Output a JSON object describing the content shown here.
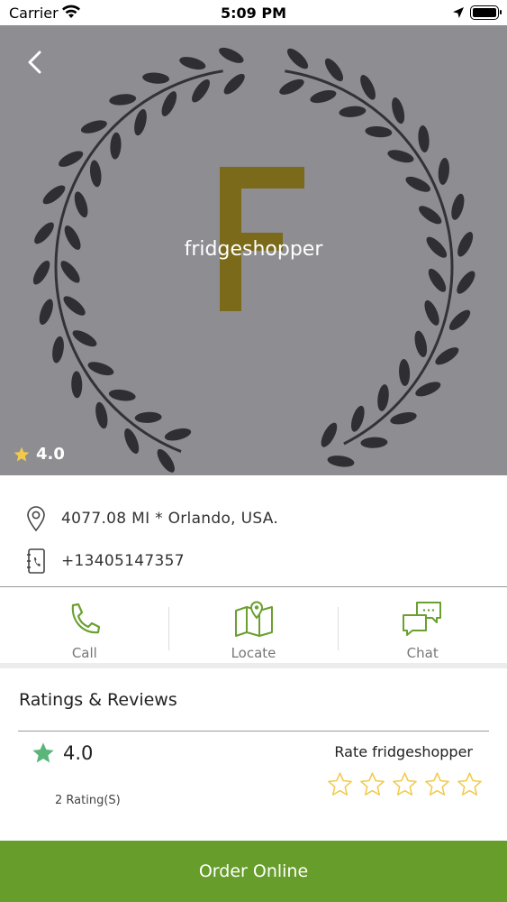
{
  "status_bar": {
    "carrier": "Carrier",
    "time": "5:09 PM"
  },
  "store": {
    "name": "fridgeshopper",
    "logo_letter": "F",
    "rating": "4.0",
    "address": "4077.08 MI * Orlando, USA.",
    "phone": "+13405147357"
  },
  "actions": [
    {
      "label": "Call",
      "icon": "phone-icon"
    },
    {
      "label": "Locate",
      "icon": "map-icon"
    },
    {
      "label": "Chat",
      "icon": "chat-icon"
    }
  ],
  "reviews": {
    "title": "Ratings & Reviews",
    "average": "4.0",
    "count_label": "2 Rating(S)",
    "rate_label": "Rate fridgeshopper",
    "star_count": 5
  },
  "order_button": "Order Online",
  "colors": {
    "accent_green": "#679d2b",
    "icon_green": "#6aa030",
    "star_gold": "#f2c94c",
    "rating_green": "#5bb57a",
    "hero_bg": "#8e8d92",
    "logo_gold": "#7a6a1a"
  }
}
